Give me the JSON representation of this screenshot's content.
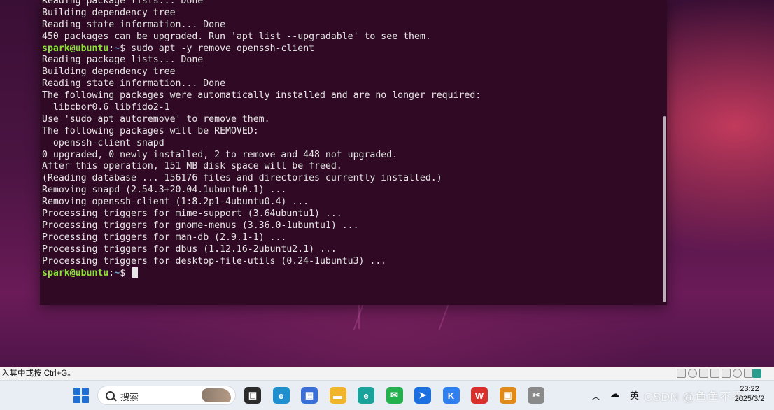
{
  "terminal": {
    "lines": [
      {
        "type": "out",
        "text": "Reading package lists... Done"
      },
      {
        "type": "out",
        "text": "Building dependency tree"
      },
      {
        "type": "out",
        "text": "Reading state information... Done"
      },
      {
        "type": "out",
        "text": "450 packages can be upgraded. Run 'apt list --upgradable' to see them."
      },
      {
        "type": "cmd",
        "user": "spark@ubuntu",
        "path": "~",
        "sep": "$ ",
        "text": "sudo apt -y remove openssh-client"
      },
      {
        "type": "out",
        "text": "Reading package lists... Done"
      },
      {
        "type": "out",
        "text": "Building dependency tree"
      },
      {
        "type": "out",
        "text": "Reading state information... Done"
      },
      {
        "type": "out",
        "text": "The following packages were automatically installed and are no longer required:"
      },
      {
        "type": "out",
        "text": "  libcbor0.6 libfido2-1"
      },
      {
        "type": "out",
        "text": "Use 'sudo apt autoremove' to remove them."
      },
      {
        "type": "out",
        "text": "The following packages will be REMOVED:"
      },
      {
        "type": "out",
        "text": "  openssh-client snapd"
      },
      {
        "type": "out",
        "text": "0 upgraded, 0 newly installed, 2 to remove and 448 not upgraded."
      },
      {
        "type": "out",
        "text": "After this operation, 151 MB disk space will be freed."
      },
      {
        "type": "out",
        "text": "(Reading database ... 156176 files and directories currently installed.)"
      },
      {
        "type": "out",
        "text": "Removing snapd (2.54.3+20.04.1ubuntu0.1) ..."
      },
      {
        "type": "out",
        "text": "Removing openssh-client (1:8.2p1-4ubuntu0.4) ..."
      },
      {
        "type": "out",
        "text": "Processing triggers for mime-support (3.64ubuntu1) ..."
      },
      {
        "type": "out",
        "text": "Processing triggers for gnome-menus (3.36.0-1ubuntu1) ..."
      },
      {
        "type": "out",
        "text": "Processing triggers for man-db (2.9.1-1) ..."
      },
      {
        "type": "out",
        "text": "Processing triggers for dbus (1.12.16-2ubuntu2.1) ..."
      },
      {
        "type": "out",
        "text": "Processing triggers for desktop-file-utils (0.24-1ubuntu3) ..."
      },
      {
        "type": "cmd",
        "user": "spark@ubuntu",
        "path": "~",
        "sep": "$ ",
        "text": "",
        "cursor": true
      }
    ]
  },
  "statusbar": {
    "hint": "入其中或按 Ctrl+G。"
  },
  "taskbar": {
    "search_placeholder": "搜索",
    "apps": [
      {
        "name": "task-view-icon",
        "glyph": "▣",
        "color": "#2b2b2b"
      },
      {
        "name": "edge-icon",
        "glyph": "e",
        "color": "#1f8fcf"
      },
      {
        "name": "store-icon",
        "glyph": "▦",
        "color": "#3a6fd8"
      },
      {
        "name": "file-explorer-icon",
        "glyph": "▬",
        "color": "#f1b52c"
      },
      {
        "name": "edge-ai-icon",
        "glyph": "e",
        "color": "#1aa39a"
      },
      {
        "name": "wechat-icon",
        "glyph": "✉",
        "color": "#22b14c"
      },
      {
        "name": "feishu-icon",
        "glyph": "➤",
        "color": "#1c6fe0"
      },
      {
        "name": "lark-icon",
        "glyph": "K",
        "color": "#2f7ff0"
      },
      {
        "name": "wps-icon",
        "glyph": "W",
        "color": "#d9302b"
      },
      {
        "name": "vmware-icon",
        "glyph": "▣",
        "color": "#e08a1a"
      },
      {
        "name": "snipping-tool-icon",
        "glyph": "✂",
        "color": "#8a8a8a"
      }
    ],
    "tray": {
      "ime_label": "英",
      "clock_time": "23:22",
      "clock_date": "2025/3/2"
    }
  },
  "watermark": "CSDN @鱼鱼不乖"
}
